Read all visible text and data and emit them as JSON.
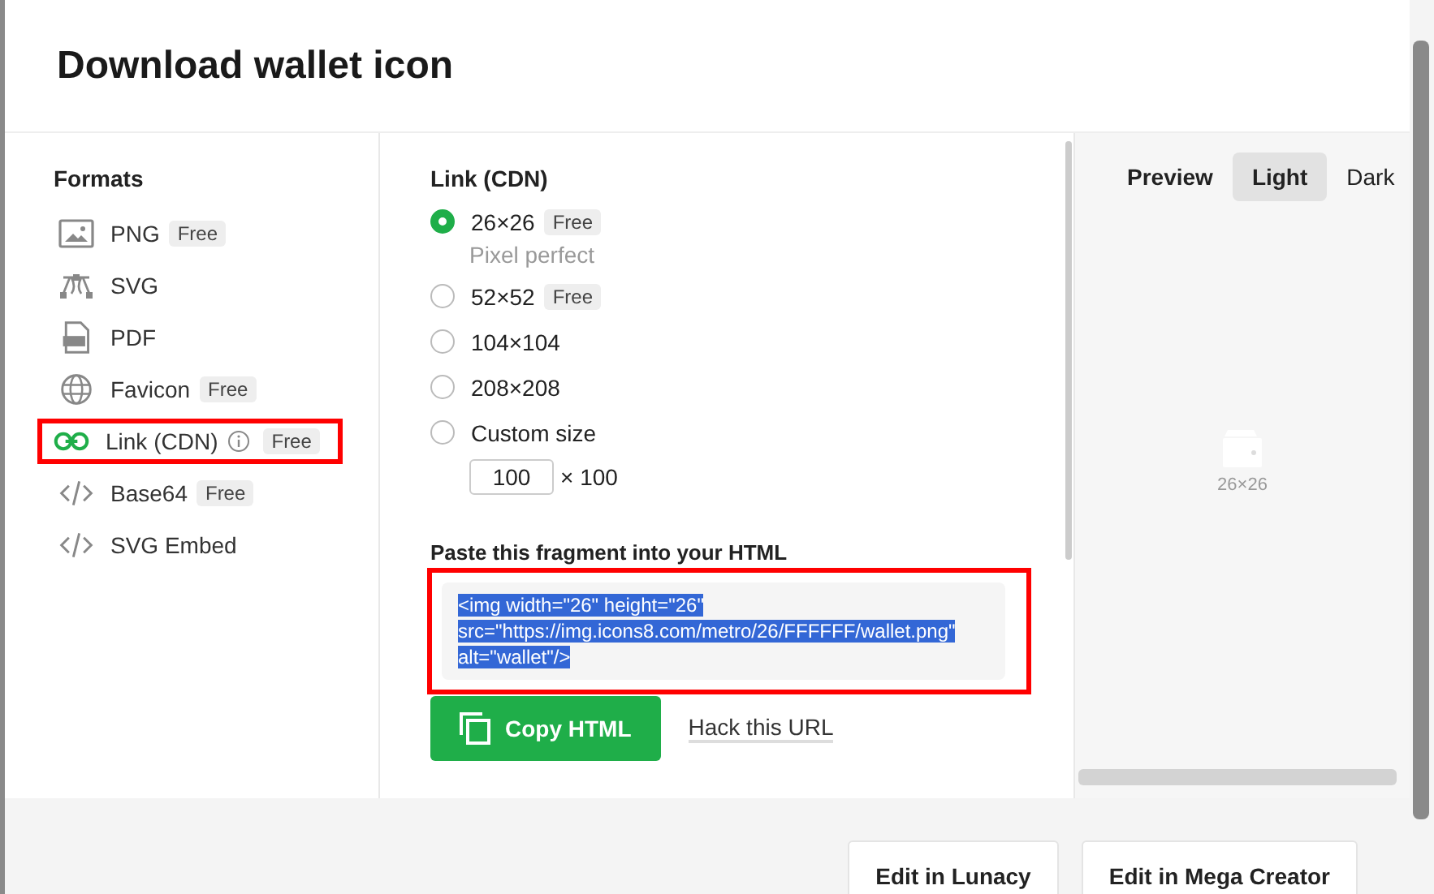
{
  "dialog": {
    "title": "Download wallet icon"
  },
  "formats": {
    "heading": "Formats",
    "items": [
      {
        "kind": "image",
        "label": "PNG",
        "badge": "Free",
        "selected": false
      },
      {
        "kind": "vector",
        "label": "SVG",
        "selected": false
      },
      {
        "kind": "pdf",
        "label": "PDF",
        "selected": false
      },
      {
        "kind": "globe",
        "label": "Favicon",
        "badge": "Free",
        "selected": false
      },
      {
        "kind": "link",
        "label": "Link (CDN)",
        "info": true,
        "badge": "Free",
        "selected": true
      },
      {
        "kind": "code",
        "label": "Base64",
        "badge": "Free",
        "selected": false
      },
      {
        "kind": "code",
        "label": "SVG Embed",
        "selected": false
      }
    ]
  },
  "options": {
    "heading": "Link (CDN)",
    "sizes": [
      {
        "kind": "preset",
        "label": "26×26",
        "badge": "Free",
        "note": "Pixel perfect",
        "selected": true
      },
      {
        "kind": "preset",
        "label": "52×52",
        "badge": "Free",
        "selected": false
      },
      {
        "kind": "preset",
        "label": "104×104",
        "selected": false
      },
      {
        "kind": "preset",
        "label": "208×208",
        "selected": false
      },
      {
        "kind": "custom",
        "label": "Custom size",
        "value": "100",
        "suffix": "× 100",
        "selected": false
      }
    ],
    "snippet": {
      "heading": "Paste this fragment into your HTML",
      "highlighted": true,
      "text_selected": true,
      "lines": [
        "<img width=\"26\" height=\"26\"",
        "src=\"https://img.icons8.com/metro/26/FFFFFF/wallet.png\"",
        "alt=\"wallet\"/>"
      ]
    },
    "copy_button": "Copy HTML",
    "hack_link": "Hack this URL"
  },
  "preview": {
    "label": "Preview",
    "tabs": [
      {
        "label": "Light",
        "selected": true
      },
      {
        "label": "Dark",
        "selected": false
      }
    ],
    "caption": "26×26"
  },
  "footer": {
    "buttons": [
      "Edit in Lunacy",
      "Edit in Mega Creator"
    ]
  }
}
